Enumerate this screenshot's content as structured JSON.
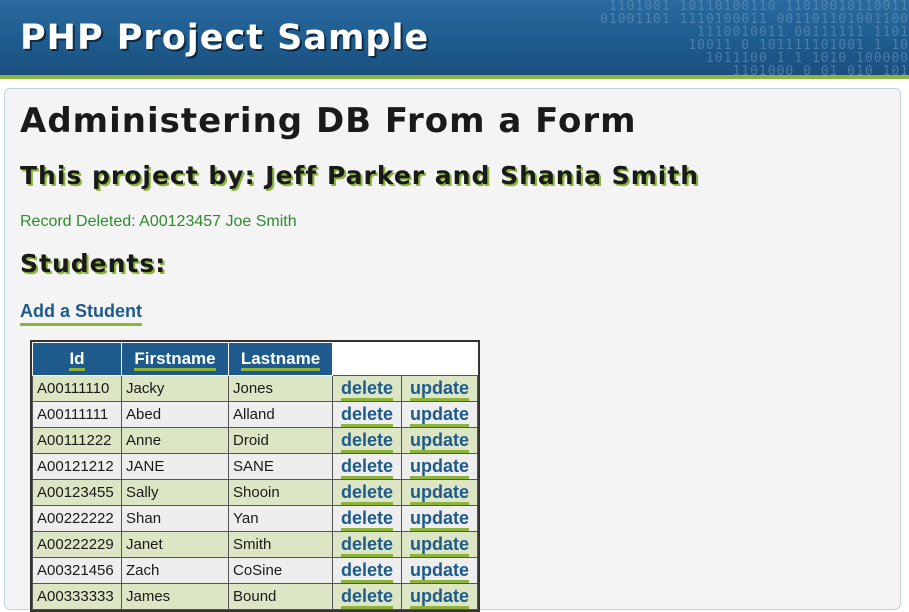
{
  "header": {
    "title": "PHP Project Sample",
    "binary_pattern": [
      "1101001 10110100110 11010010110011",
      "01001101 1110100011 001101101001100",
      "1110010011 00111111 1101",
      "10011 0 101111101001 1 10",
      "1011100 1 1 1010 100000",
      "1101000 0 01 010 101"
    ]
  },
  "main": {
    "page_title": "Administering DB From a Form",
    "byline": "This project by: Jeff Parker and Shania Smith",
    "status_message": "Record Deleted: A00123457 Joe Smith",
    "section_title": "Students:",
    "add_link": "Add a Student"
  },
  "table": {
    "columns": [
      "Id",
      "Firstname",
      "Lastname"
    ],
    "delete_label": "delete",
    "update_label": "update",
    "rows": [
      {
        "id": "A00111110",
        "first": "Jacky",
        "last": "Jones"
      },
      {
        "id": "A00111111",
        "first": "Abed",
        "last": "Alland"
      },
      {
        "id": "A00111222",
        "first": "Anne",
        "last": "Droid"
      },
      {
        "id": "A00121212",
        "first": "JANE",
        "last": "SANE"
      },
      {
        "id": "A00123455",
        "first": "Sally",
        "last": "Shooin"
      },
      {
        "id": "A00222222",
        "first": "Shan",
        "last": "Yan"
      },
      {
        "id": "A00222229",
        "first": "Janet",
        "last": "Smith"
      },
      {
        "id": "A00321456",
        "first": "Zach",
        "last": "CoSine"
      },
      {
        "id": "A00333333",
        "first": "James",
        "last": "Bound"
      }
    ]
  },
  "colors": {
    "header_blue": "#1e5a8c",
    "accent_green": "#8cb43c",
    "status_green": "#2e8b2e",
    "row_odd": "#dde6c4",
    "row_even": "#eeeeee"
  }
}
